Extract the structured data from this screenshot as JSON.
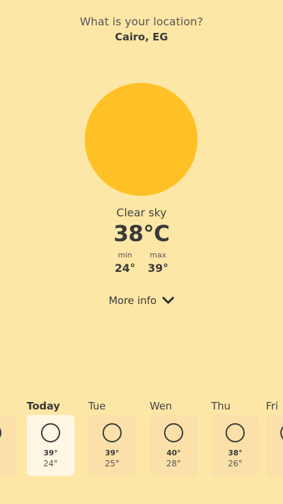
{
  "location": {
    "prompt": "What is your location?",
    "value": "Cairo, EG"
  },
  "current": {
    "condition": "Clear sky",
    "temperature": "38°C",
    "min_label": "min",
    "min_value": "24°",
    "max_label": "max",
    "max_value": "39°"
  },
  "more_info": {
    "label": "More info",
    "icon": "chevron-down-icon"
  },
  "forecast": [
    {
      "day": "",
      "high": "",
      "low": "",
      "icon": "sun-outline-icon",
      "active": false
    },
    {
      "day": "Today",
      "high": "39°",
      "low": "24°",
      "icon": "sun-outline-icon",
      "active": true
    },
    {
      "day": "Tue",
      "high": "39°",
      "low": "25°",
      "icon": "sun-outline-icon",
      "active": false
    },
    {
      "day": "Wen",
      "high": "40°",
      "low": "28°",
      "icon": "sun-outline-icon",
      "active": false
    },
    {
      "day": "Thu",
      "high": "38°",
      "low": "26°",
      "icon": "sun-outline-icon",
      "active": false
    },
    {
      "day": "Fri",
      "high": "",
      "low": "",
      "icon": "sun-outline-icon",
      "active": false
    }
  ],
  "colors": {
    "background": "#fde7a6",
    "sun": "#ffc126",
    "card": "#fbe0a9",
    "card_active": "#fff7e3"
  }
}
